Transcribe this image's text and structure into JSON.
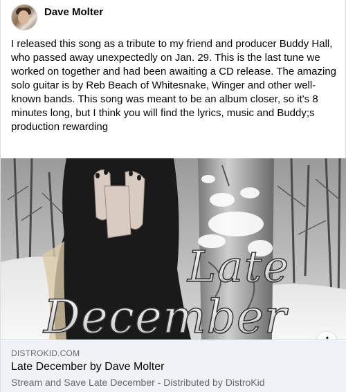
{
  "post": {
    "author": "Dave Molter",
    "text": "I released this song as a tribute to my friend and producer Buddy Hall, who passed away unexpectedly on Jan. 29. This is the last tune we worked on together and had been awaiting a CD release.  The amazing solo guitar is by Reb Beach of Whitesnake, Winger and other well-known bands. This song was meant to be an album closer, so it's 8 minutes long, but I think you will find the lyrics, music and Buddy;s production rewarding"
  },
  "media": {
    "overlay_line1": "Late",
    "overlay_line2": "December",
    "info_icon": "info-icon",
    "info_symbol": "i"
  },
  "link_preview": {
    "domain": "DISTROKID.COM",
    "title": "Late December by Dave Molter",
    "description": "Stream and Save Late December - Distributed by DistroKid"
  }
}
